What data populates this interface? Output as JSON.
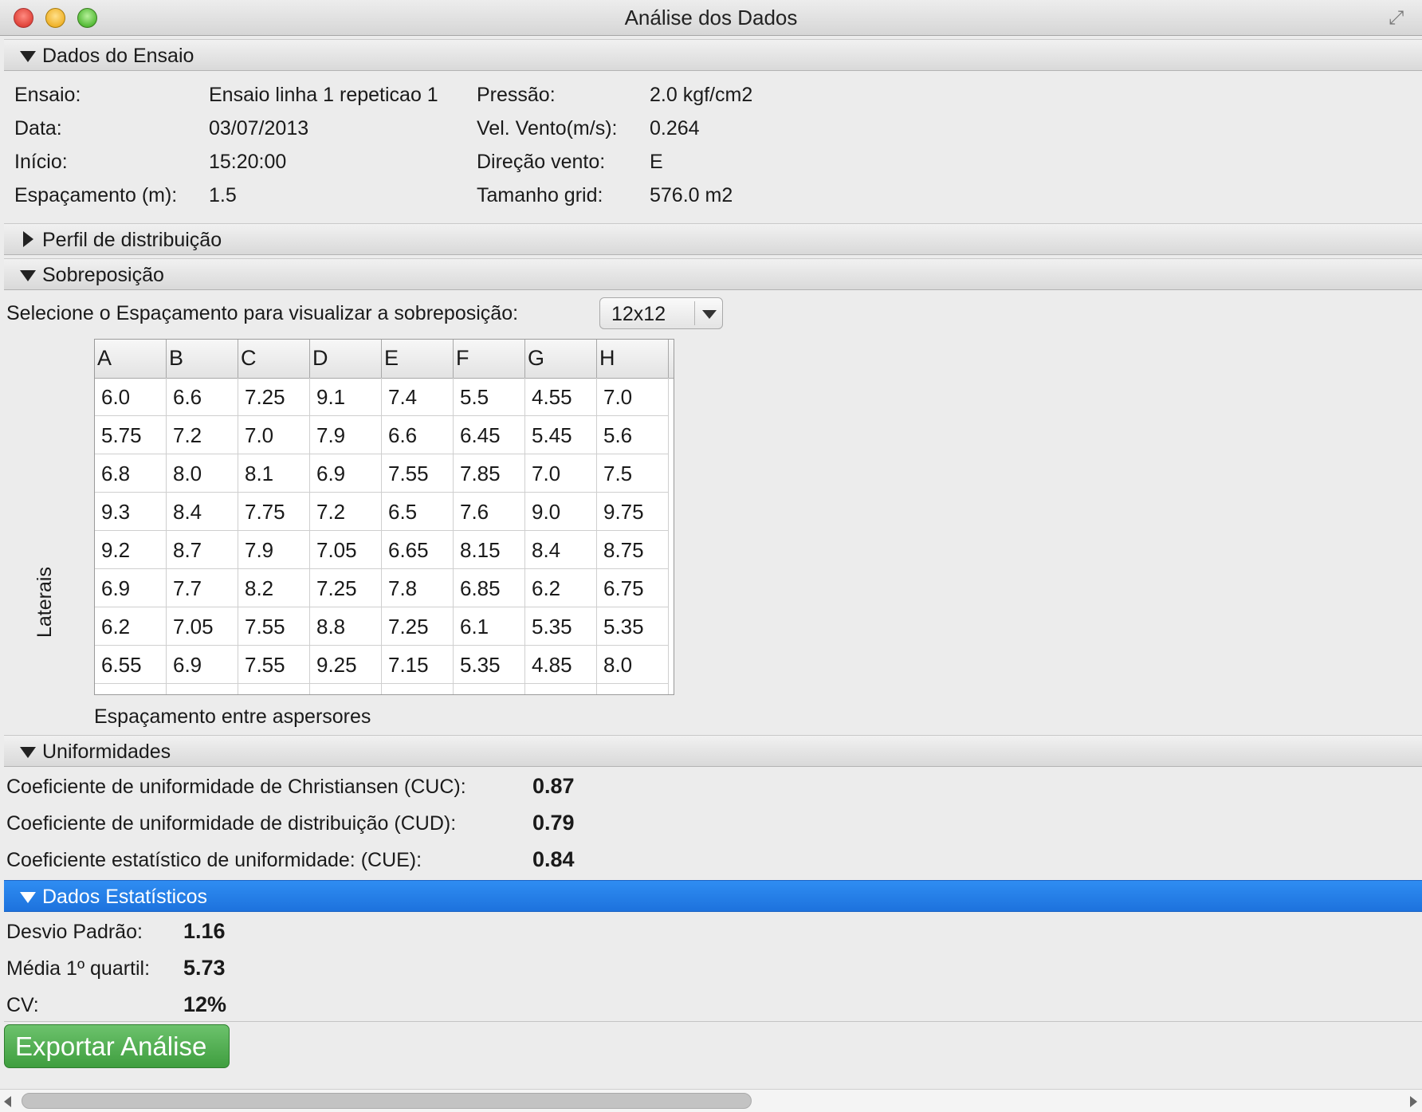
{
  "window": {
    "title": "Análise dos Dados"
  },
  "sections": {
    "dados_ensaio": {
      "label": "Dados do Ensaio"
    },
    "perfil": {
      "label": "Perfil de distribuição"
    },
    "sobreposicao": {
      "label": "Sobreposição"
    },
    "uniformidades": {
      "label": "Uniformidades"
    },
    "estatisticos": {
      "label": "Dados Estatísticos"
    }
  },
  "ensaio": {
    "ensaio_label": "Ensaio:",
    "ensaio_value": "Ensaio linha 1 repeticao 1",
    "data_label": "Data:",
    "data_value": "03/07/2013",
    "inicio_label": "Início:",
    "inicio_value": "15:20:00",
    "espacamento_label": "Espaçamento (m):",
    "espacamento_value": "1.5",
    "pressao_label": "Pressão:",
    "pressao_value": "2.0 kgf/cm2",
    "vento_label": "Vel. Vento(m/s):",
    "vento_value": "0.264",
    "direcao_label": "Direção vento:",
    "direcao_value": "E",
    "grid_label": "Tamanho grid:",
    "grid_value": "576.0 m2"
  },
  "sobreposicao": {
    "prompt": "Selecione o Espaçamento para visualizar a sobreposição:",
    "selected": "12x12",
    "vertical_label": "Laterais",
    "horizontal_label": "Espaçamento entre aspersores",
    "columns": [
      "A",
      "B",
      "C",
      "D",
      "E",
      "F",
      "G",
      "H"
    ],
    "rows": [
      [
        "6.0",
        "6.6",
        "7.25",
        "9.1",
        "7.4",
        "5.5",
        "4.55",
        "7.0"
      ],
      [
        "5.75",
        "7.2",
        "7.0",
        "7.9",
        "6.6",
        "6.45",
        "5.45",
        "5.6"
      ],
      [
        "6.8",
        "8.0",
        "8.1",
        "6.9",
        "7.55",
        "7.85",
        "7.0",
        "7.5"
      ],
      [
        "9.3",
        "8.4",
        "7.75",
        "7.2",
        "6.5",
        "7.6",
        "9.0",
        "9.75"
      ],
      [
        "9.2",
        "8.7",
        "7.9",
        "7.05",
        "6.65",
        "8.15",
        "8.4",
        "8.75"
      ],
      [
        "6.9",
        "7.7",
        "8.2",
        "7.25",
        "7.8",
        "6.85",
        "6.2",
        "6.75"
      ],
      [
        "6.2",
        "7.05",
        "7.55",
        "8.8",
        "7.25",
        "6.1",
        "5.35",
        "5.35"
      ],
      [
        "6.55",
        "6.9",
        "7.55",
        "9.25",
        "7.15",
        "5.35",
        "4.85",
        "8.0"
      ]
    ]
  },
  "uniformidades": {
    "cuc_label": "Coeficiente de uniformidade de Christiansen (CUC):",
    "cuc_value": "0.87",
    "cud_label": "Coeficiente de uniformidade de distribuição (CUD):",
    "cud_value": "0.79",
    "cue_label": "Coeficiente estatístico de uniformidade: (CUE):",
    "cue_value": "0.84"
  },
  "estatisticos": {
    "desvio_label": "Desvio Padrão:",
    "desvio_value": "1.16",
    "media_label": "Média 1º quartil:",
    "media_value": "5.73",
    "cv_label": "CV:",
    "cv_value": "12%"
  },
  "export_button": "Exportar Análise"
}
